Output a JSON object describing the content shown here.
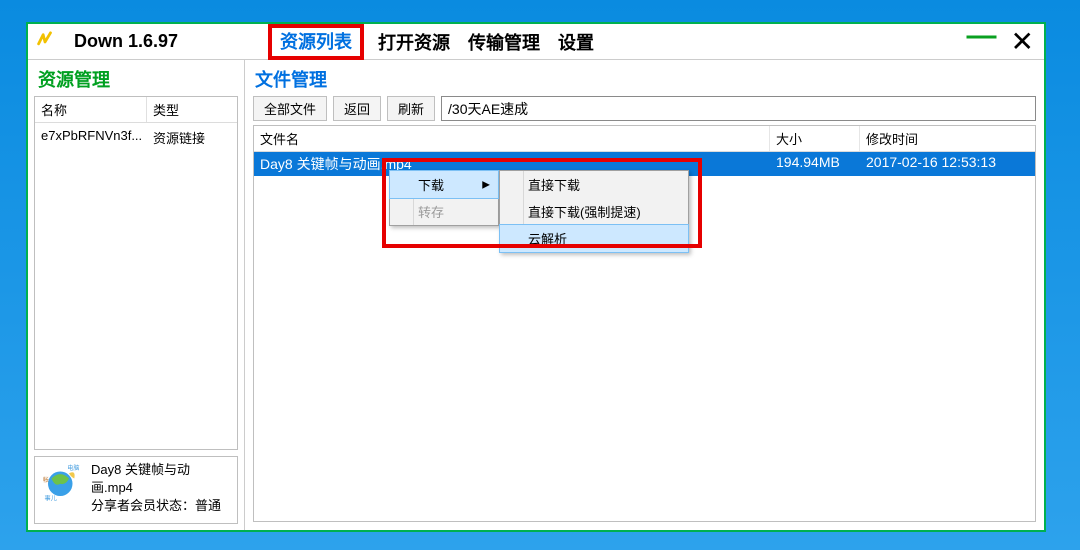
{
  "app": {
    "title": "Down 1.6.97",
    "nav": {
      "resource_list": "资源列表",
      "open_resource": "打开资源",
      "transfer_manage": "传输管理",
      "settings": "设置"
    }
  },
  "sidebar": {
    "title": "资源管理",
    "headers": {
      "name": "名称",
      "type": "类型"
    },
    "rows": [
      {
        "name": "e7xPbRFNVn3f...",
        "type": "资源链接"
      }
    ],
    "info": {
      "filename": "Day8 关键帧与动画.mp4",
      "sharer_status_label": "分享者会员状态：",
      "sharer_status_value": "普通",
      "icon_labels": {
        "top": "电脑",
        "left": "帐",
        "bottom": "事儿",
        "right": "边"
      }
    }
  },
  "main": {
    "title": "文件管理",
    "toolbar": {
      "all_files": "全部文件",
      "back": "返回",
      "refresh": "刷新",
      "path": "/30天AE速成"
    },
    "columns": {
      "name": "文件名",
      "size": "大小",
      "time": "修改时间"
    },
    "rows": [
      {
        "name": "Day8 关键帧与动画.mp4",
        "size": "194.94MB",
        "time": "2017-02-16 12:53:13"
      }
    ]
  },
  "context_menu": {
    "download": "下载",
    "transfer_save": "转存",
    "submenu": {
      "direct_download": "直接下载",
      "direct_download_boost": "直接下载(强制提速)",
      "cloud_parse": "云解析"
    }
  }
}
